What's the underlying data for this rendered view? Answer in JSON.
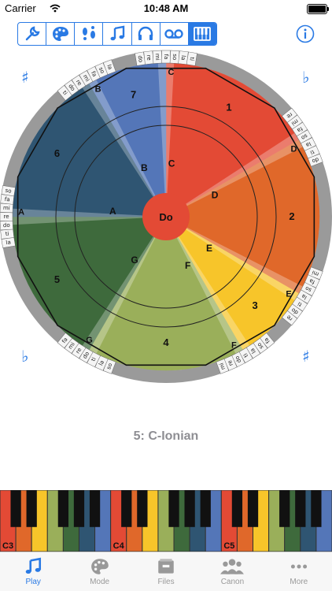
{
  "status": {
    "carrier": "Carrier",
    "time": "10:48 AM"
  },
  "toolbar": {
    "tools": [
      "wrench-icon",
      "palette-icon",
      "footprints-icon",
      "music-note-icon",
      "headphones-icon",
      "voicemail-icon",
      "piano-icon"
    ],
    "active_tool": "piano-icon",
    "accent": "#2a7ae4"
  },
  "accidentals": {
    "sharp": "♯",
    "flat": "♭"
  },
  "wheel": {
    "center_label": "Do",
    "segments": [
      {
        "number": "1",
        "letter": "C",
        "color": "#e34a35"
      },
      {
        "number": "2",
        "letter": "D",
        "color": "#e0682a"
      },
      {
        "number": "3",
        "letter": "E",
        "color": "#f7c52a"
      },
      {
        "number": "4",
        "letter": "F",
        "color": "#9aaf5a"
      },
      {
        "number": "5",
        "letter": "G",
        "color": "#3e6a3c"
      },
      {
        "number": "6",
        "letter": "A",
        "color": "#2f5572"
      },
      {
        "number": "7",
        "letter": "B",
        "color": "#5476b8"
      }
    ],
    "solfege": [
      "do",
      "re",
      "mi",
      "fa",
      "so",
      "la",
      "ti"
    ]
  },
  "mode_label": "5: C-Ionian",
  "keyboard": {
    "octave_labels": [
      "C3",
      "C4",
      "C5"
    ],
    "key_colors": [
      "#e34a35",
      "#e0682a",
      "#f7c52a",
      "#9aaf5a",
      "#3e6a3c",
      "#2f5572",
      "#5476b8"
    ]
  },
  "tabbar": {
    "tabs": [
      {
        "label": "Play",
        "icon": "music-note-icon",
        "active": true
      },
      {
        "label": "Mode",
        "icon": "palette-icon",
        "active": false
      },
      {
        "label": "Files",
        "icon": "tray-icon",
        "active": false
      },
      {
        "label": "Canon",
        "icon": "group-icon",
        "active": false
      },
      {
        "label": "More",
        "icon": "more-icon",
        "active": false
      }
    ]
  }
}
